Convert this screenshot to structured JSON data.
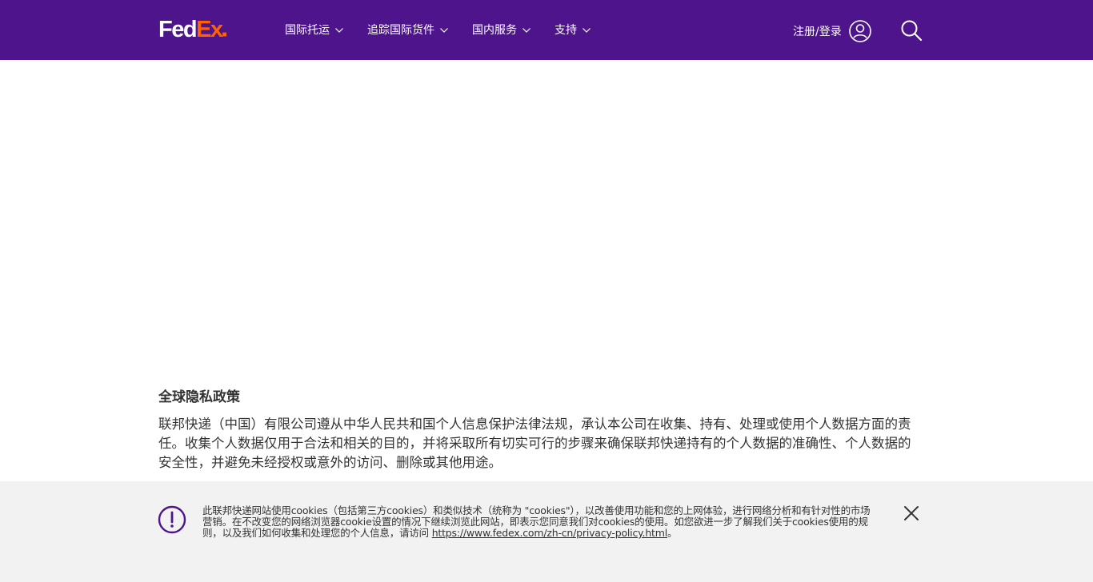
{
  "header": {
    "logo_primary": "Fed",
    "logo_secondary": "Ex",
    "nav": [
      {
        "label": "国际托运"
      },
      {
        "label": "追踪国际货件"
      },
      {
        "label": "国内服务"
      },
      {
        "label": "支持"
      }
    ],
    "login_label": "注册/登录",
    "icons": {
      "user": "user-circle-icon",
      "search": "search-icon"
    }
  },
  "privacy": {
    "title": "全球隐私政策",
    "body": "联邦快递（中国）有限公司遵从中华人民共和国个人信息保护法律法规，承认本公司在收集、持有、处理或使用个人数据方面的责任。收集个人数据仅用于合法和相关的目的，并将采取所有切实可行的步骤来确保联邦快递持有的个人数据的准确性、个人数据的安全性，并避免未经授权或意外的访问、删除或其他用途。"
  },
  "cookie_banner": {
    "text": "此联邦快递网站使用cookies（包括第三方cookies）和类似技术（统称为 \"cookies\"），以改善使用功能和您的上网体验，进行网络分析和有针对性的市场营销。在不改变您的网络浏览器cookie设置的情况下继续浏览此网站，即表示您同意我们对cookies的使用。如您欲进一步了解我们关于cookies使用的规则，以及我们如何收集和处理您的个人信息，请访问 ",
    "link": "https://www.fedex.com/zh-cn/privacy-policy.html",
    "suffix": "。",
    "icons": {
      "alert": "alert-icon",
      "close": "close-icon"
    }
  },
  "colors": {
    "brand_purple": "#4d148c",
    "brand_orange": "#ff6200",
    "banner_bg": "#f2f2f2"
  }
}
